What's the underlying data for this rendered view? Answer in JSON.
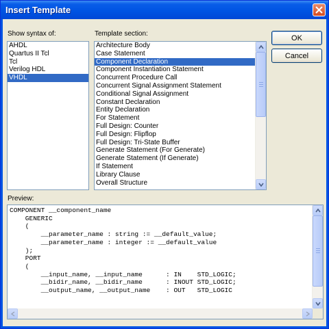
{
  "window": {
    "title": "Insert Template"
  },
  "syntax": {
    "label": "Show syntax of:",
    "items": [
      "AHDL",
      "Quartus II Tcl",
      "Tcl",
      "Verilog HDL",
      "VHDL"
    ],
    "selected": "VHDL"
  },
  "section": {
    "label": "Template section:",
    "items": [
      "Architecture Body",
      "Case Statement",
      "Component Declaration",
      "Component Instantiation Statement",
      "Concurrent Procedure Call",
      "Concurrent Signal Assignment Statement",
      "Conditional Signal Assignment",
      "Constant Declaration",
      "Entity Declaration",
      "For Statement",
      "Full Design: Counter",
      "Full Design: Flipflop",
      "Full Design: Tri-State Buffer",
      "Generate Statement (For Generate)",
      "Generate Statement (If Generate)",
      "If Statement",
      "Library Clause",
      "Overall Structure"
    ],
    "selected": "Component Declaration"
  },
  "buttons": {
    "ok": "OK",
    "cancel": "Cancel"
  },
  "preview": {
    "label": "Preview:",
    "lines": [
      "COMPONENT __component_name",
      "    GENERIC",
      "    (",
      "        __parameter_name : string := __default_value;",
      "        __parameter_name : integer := __default_value",
      "    );",
      "    PORT",
      "    (",
      "        __input_name, __input_name      : IN    STD_LOGIC;",
      "        __bidir_name, __bidir_name      : INOUT STD_LOGIC;",
      "        __output_name, __output_name    : OUT   STD_LOGIC"
    ]
  },
  "colors": {
    "selection": "#316ac5",
    "title_bar": "#0054e3",
    "dialog_face": "#ece9d8"
  }
}
